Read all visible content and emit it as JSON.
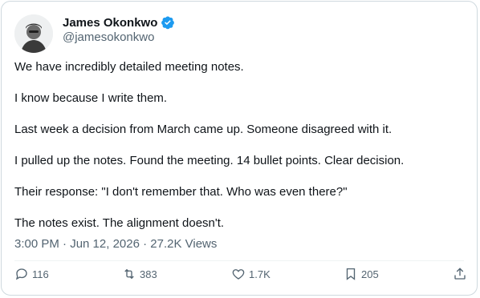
{
  "author": {
    "name": "James Okonkwo",
    "handle": "@jamesokonkwo",
    "verified_color": "#1d9bf0"
  },
  "paragraphs": [
    "We have incredibly detailed meeting notes.",
    "I know because I write them.",
    "Last week a decision from March came up. Someone disagreed with it.",
    "I pulled up the notes. Found the meeting. 14 bullet points. Clear decision.",
    "Their response: \"I don't remember that. Who was even there?\"",
    "The notes exist. The alignment doesn't."
  ],
  "meta": "3:00 PM · Jun 12, 2026 · 27.2K Views",
  "actions": {
    "replies": "116",
    "reposts": "383",
    "likes": "1.7K",
    "bookmarks": "205"
  },
  "icons": [
    "reply-icon",
    "repost-icon",
    "like-icon",
    "bookmark-icon",
    "share-icon",
    "verified-badge-icon"
  ]
}
